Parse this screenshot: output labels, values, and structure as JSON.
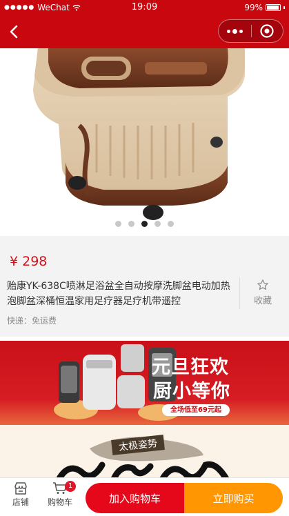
{
  "status_bar": {
    "carrier": "WeChat",
    "time": "19:09",
    "battery": "99%"
  },
  "product": {
    "price": "¥ 298",
    "title": "贻康YK-638C喷淋足浴盆全自动按摩洗脚盆电动加热泡脚盆深桶恒温家用足疗器足疗机带遥控",
    "favorite_label": "收藏",
    "shipping": "快递：免运费",
    "image_count": 5,
    "current_image": 3
  },
  "banner1": {
    "line1": "元旦狂欢",
    "line2": "厨小等你",
    "pill": "全场低至69元起"
  },
  "banner2": {
    "tag": "太极姿势"
  },
  "bottom_bar": {
    "shop_label": "店铺",
    "cart_label": "购物车",
    "cart_badge": "1",
    "add_to_cart": "加入购物车",
    "buy_now": "立即购买"
  },
  "colors": {
    "brand": "#c8070f",
    "price": "#d0121b",
    "cart_button": "#e4081a",
    "buy_button": "#ff9602"
  },
  "icons": [
    "back-arrow-icon",
    "more-dots-icon",
    "close-target-icon",
    "star-outline-icon",
    "shop-icon",
    "cart-icon"
  ]
}
